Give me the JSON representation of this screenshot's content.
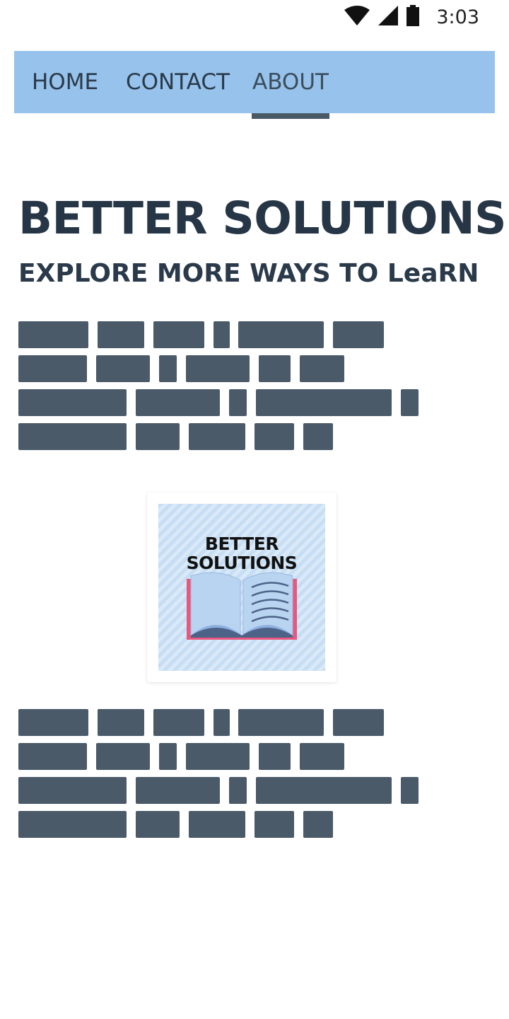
{
  "status_bar": {
    "time": "3:03",
    "icons": [
      "wifi-icon",
      "signal-icon",
      "battery-icon"
    ]
  },
  "nav": {
    "items": [
      {
        "label": "HOME"
      },
      {
        "label": "CONTACT"
      },
      {
        "label": "ABOUT",
        "active": true
      }
    ]
  },
  "hero": {
    "title": "BETTER SOLUTIONS",
    "subtitle": "EXPLORE MORE WAYS TO LeaRN"
  },
  "logo": {
    "text_line_1": "BETTER",
    "text_line_2": "SOLUTIONS"
  },
  "colors": {
    "nav_background": "#96c2eb",
    "nav_indicator": "#4a5966",
    "heading_text": "#263646",
    "redacted_block": "#4a5a68",
    "book_cover": "#e8577e"
  }
}
